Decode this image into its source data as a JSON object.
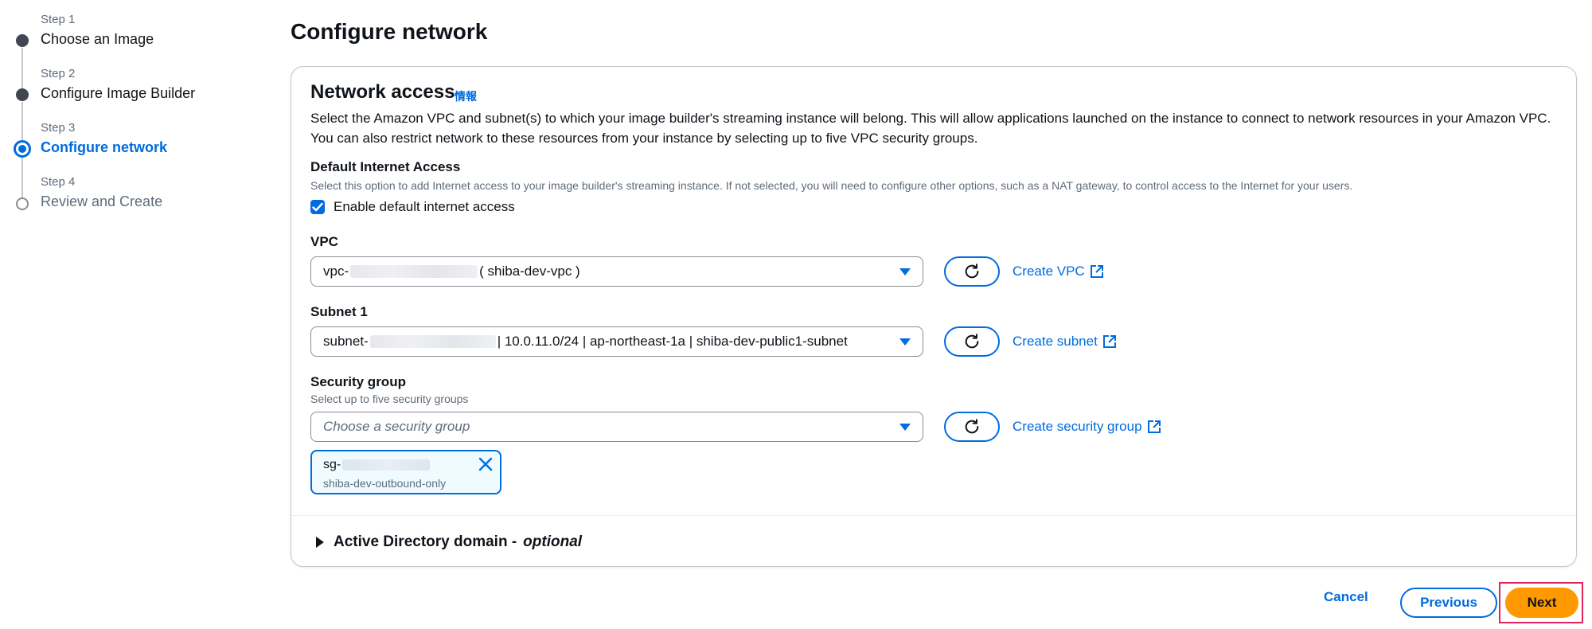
{
  "wizard": {
    "steps": [
      {
        "number": "Step 1",
        "title": "Choose an Image"
      },
      {
        "number": "Step 2",
        "title": "Configure Image Builder"
      },
      {
        "number": "Step 3",
        "title": "Configure network"
      },
      {
        "number": "Step 4",
        "title": "Review and Create"
      }
    ]
  },
  "page": {
    "title": "Configure network"
  },
  "network_access": {
    "title": "Network access",
    "info_link": "情報",
    "description": "Select the Amazon VPC and subnet(s) to which your image builder's streaming instance will belong. This will allow applications launched on the instance to connect to network resources in your Amazon VPC. You can also restrict network to these resources from your instance by selecting up to five VPC security groups.",
    "default_internet": {
      "label": "Default Internet Access",
      "hint": "Select this option to add Internet access to your image builder's streaming instance. If not selected, you will need to configure other options, such as a NAT gateway, to control access to the Internet for your users.",
      "checkbox_label": "Enable default internet access",
      "checked": true
    },
    "vpc": {
      "label": "VPC",
      "value_prefix": "vpc-",
      "value_suffix": "( shiba-dev-vpc )",
      "create_link": "Create VPC"
    },
    "subnet": {
      "label": "Subnet 1",
      "value_prefix": "subnet-",
      "value_suffix": "| 10.0.11.0/24 | ap-northeast-1a | shiba-dev-public1-subnet",
      "create_link": "Create subnet"
    },
    "security_group": {
      "label": "Security group",
      "hint": "Select up to five security groups",
      "placeholder": "Choose a security group",
      "create_link": "Create security group",
      "selected": [
        {
          "id_prefix": "sg-",
          "name": "shiba-dev-outbound-only"
        }
      ]
    },
    "active_directory": {
      "title": "Active Directory domain -",
      "optional": "optional"
    }
  },
  "actions": {
    "cancel": "Cancel",
    "previous": "Previous",
    "next": "Next"
  },
  "colors": {
    "accent": "#006ce0",
    "primary_button": "#ff9900",
    "highlight_frame": "#e0245e"
  }
}
